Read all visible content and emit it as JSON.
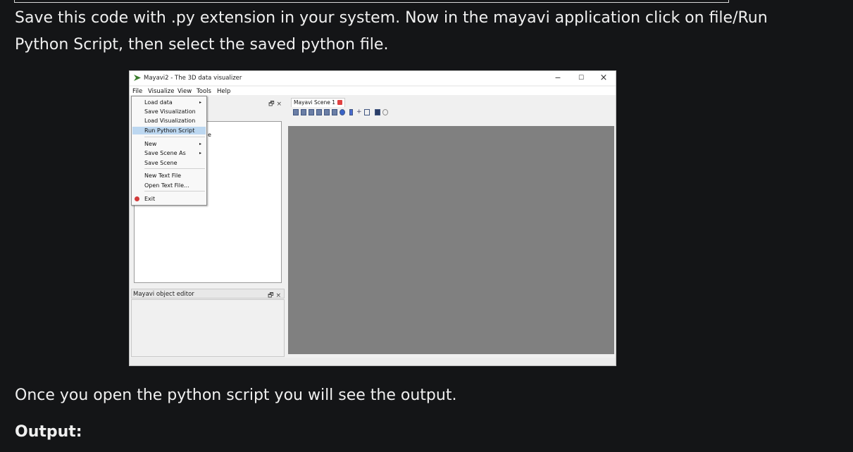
{
  "text": {
    "para1": "Save this code with .py extension in your system. Now in the mayavi application click on file/Run Python Script, then select the saved python file.",
    "para2": "Once you open the python script you will see the output.",
    "output_heading": "Output:"
  },
  "screenshot": {
    "window_title": "Mayavi2 - The 3D data visualizer",
    "window_controls": {
      "minimize": "−",
      "maximize": "☐",
      "close": "×"
    },
    "menubar": [
      "File",
      "Visualize",
      "View",
      "Tools",
      "Help"
    ],
    "file_menu": {
      "items": [
        "Load data",
        "Save Visualization",
        "Load Visualization",
        "Run Python Script",
        "New",
        "Save Scene As",
        "Save Scene",
        "New Text File",
        "Open Text File...",
        "Exit"
      ],
      "selected": "Run Python Script",
      "submenu_marker": "▸"
    },
    "pane_buttons": "🗗 ×",
    "partial_tree_glyph": "e",
    "object_editor_label": "Mayavi object editor",
    "scene_tab_label": "Mayavi Scene 1",
    "icons": [
      "app-icon",
      "view-x-icon",
      "view-y-icon",
      "view-z-icon",
      "iso-icon",
      "save-icon",
      "exit-icon"
    ],
    "viewport_color": "#808080",
    "selected_item_color": "#bcd7f0"
  }
}
